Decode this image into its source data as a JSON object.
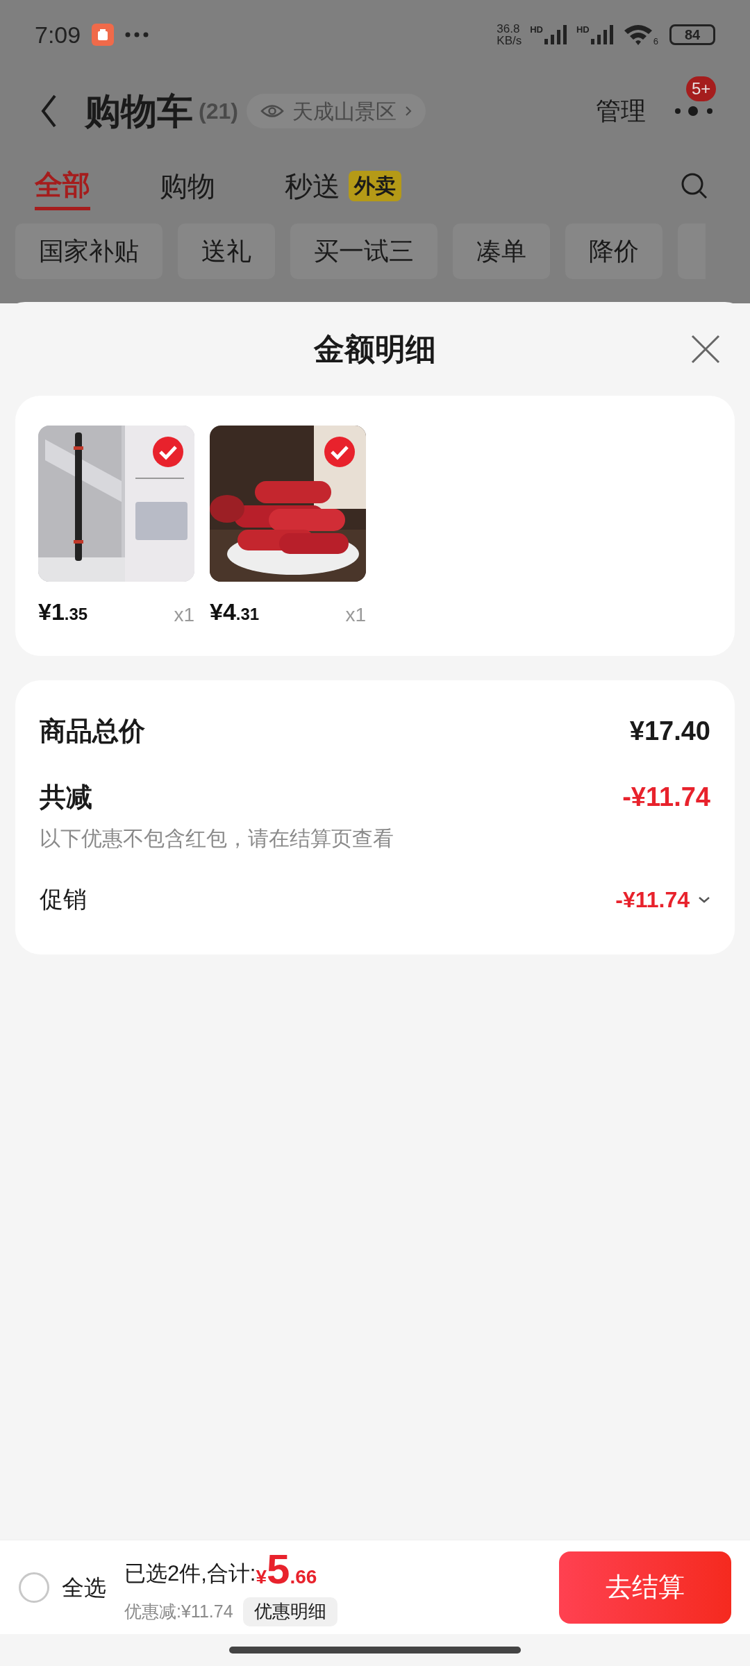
{
  "status_bar": {
    "time": "7:09",
    "net_speed": "36.8",
    "net_unit": "KB/s",
    "sim_labels": [
      "HD",
      "HD"
    ],
    "wifi_label": "6",
    "battery": "84"
  },
  "header": {
    "title": "购物车",
    "count": "(21)",
    "location": "天成山景区",
    "manage": "管理",
    "badge": "5+"
  },
  "tabs": [
    {
      "label": "全部",
      "selected": true
    },
    {
      "label": "购物",
      "selected": false
    },
    {
      "label": "秒送",
      "selected": false,
      "tag": "外卖"
    }
  ],
  "filters": [
    "国家补贴",
    "送礼",
    "买一试三",
    "凑单",
    "降价"
  ],
  "sheet": {
    "title": "金额明细",
    "items": [
      {
        "kind": "pen",
        "price": "¥1.35",
        "qty": "x1",
        "checked": true
      },
      {
        "kind": "sausage",
        "price": "¥4.31",
        "qty": "x1",
        "checked": true
      }
    ],
    "total": {
      "label": "商品总价",
      "value": "¥17.40"
    },
    "discount": {
      "label": "共减",
      "value": "-¥11.74",
      "note": "以下优惠不包含红包，请在结算页查看"
    },
    "promo": {
      "label": "促销",
      "value": "-¥11.74",
      "expanded": false
    }
  },
  "bottom_bar": {
    "select_all": {
      "label": "全选",
      "checked": false
    },
    "summary": "已选2件,合计:",
    "currency": "¥",
    "amount": "5.66",
    "saving": "优惠减:¥11.74",
    "detail_button": "优惠明细",
    "checkout": "去结算"
  }
}
